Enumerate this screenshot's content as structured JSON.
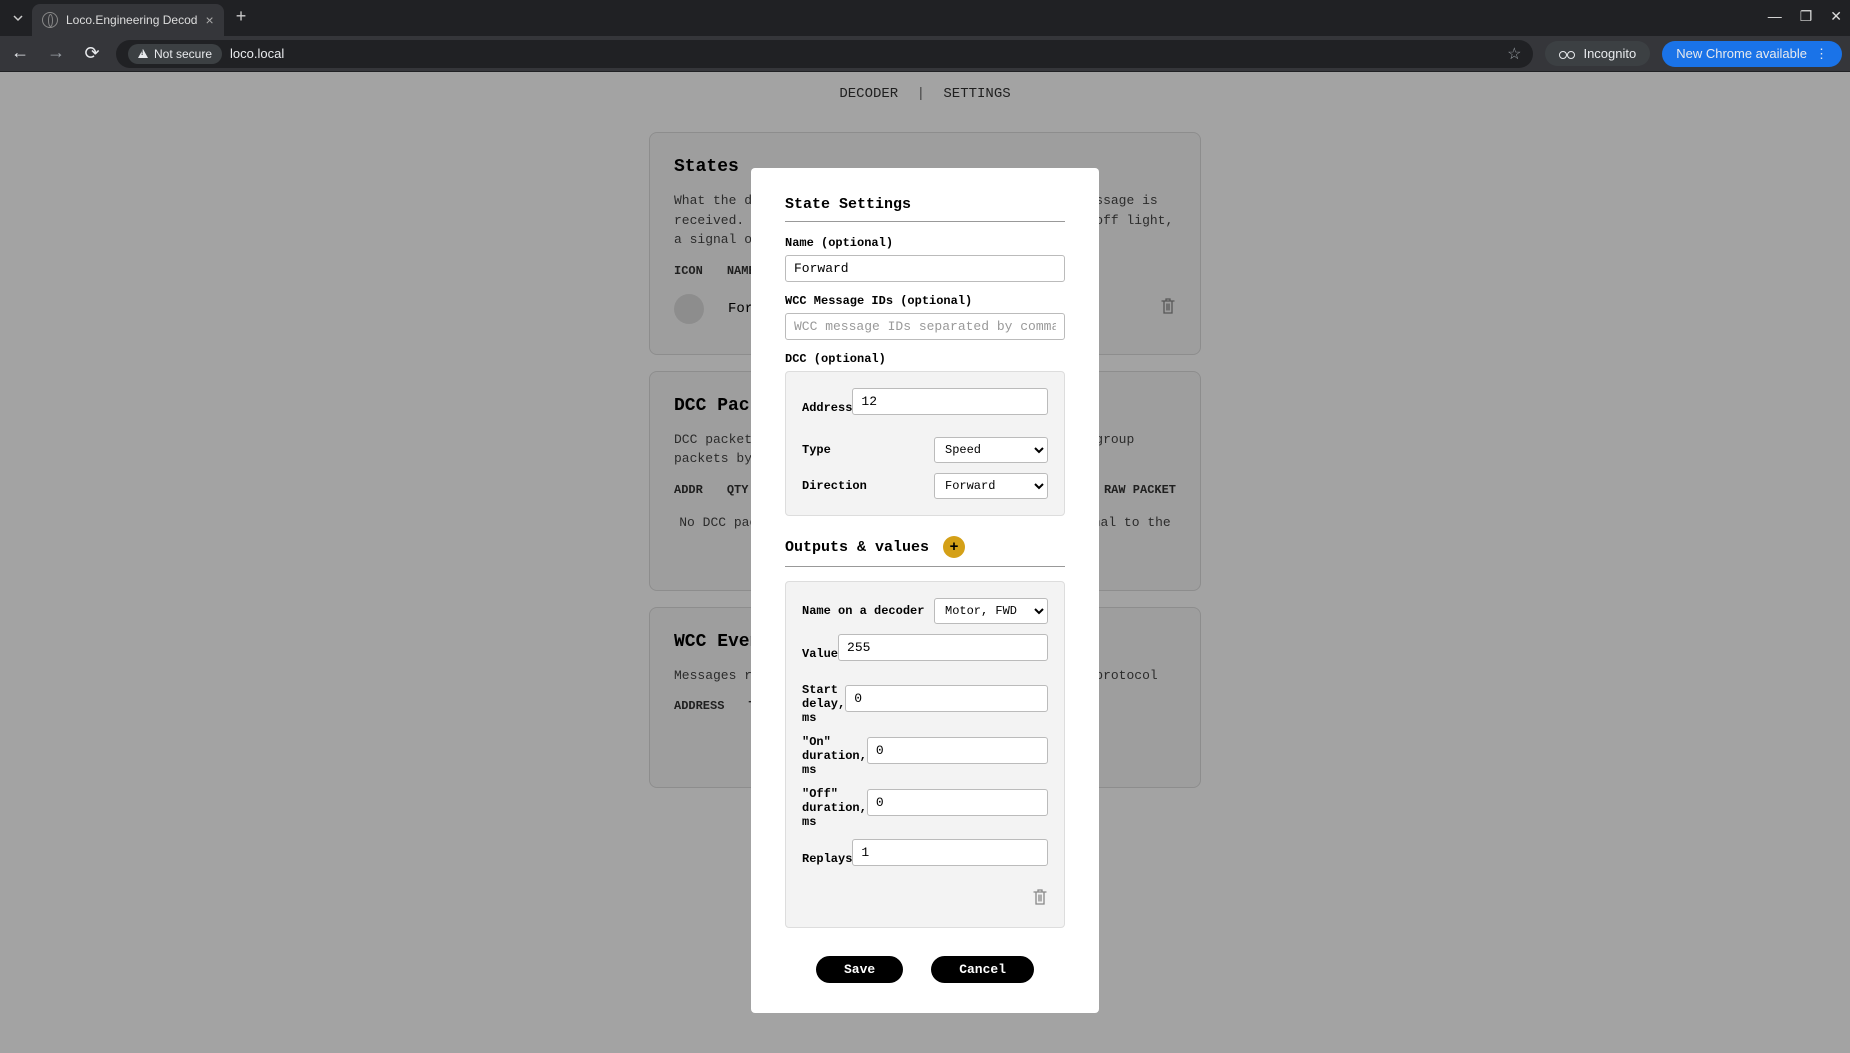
{
  "browser": {
    "tab_title": "Loco.Engineering Decod",
    "not_secure": "Not secure",
    "url": "loco.local",
    "incognito": "Incognito",
    "update": "New Chrome available"
  },
  "nav": {
    "decoder": "DECODER",
    "settings": "SETTINGS"
  },
  "states_card": {
    "title": "States",
    "desc": "What the decoder should do when a DCC packet or WCC message is received. For example, you can add a state to turn on/off light, a signal or play sound on a layout",
    "col_icon": "ICON",
    "col_name": "NAME",
    "row_name": "Forward"
  },
  "dcc_card": {
    "title": "DCC Packets",
    "desc": "DCC packets that the decoder receives. By default, we group packets by address and packet type",
    "col_addr": "ADDR",
    "col_qty": "QTY",
    "col_raw": "RAW PACKET",
    "empty": "No DCC packets received. Try to send a DCC packet/signal to the decoder"
  },
  "wcc_card": {
    "title": "WCC Events",
    "desc": "Messages received from other WCC devices over the WCC protocol",
    "col_addr": "ADDRESS",
    "col_type": "TYPE"
  },
  "modal": {
    "title": "State Settings",
    "name_label": "Name (optional)",
    "name_value": "Forward",
    "wcc_label": "WCC Message IDs (optional)",
    "wcc_placeholder": "WCC message IDs separated by comma",
    "dcc_label": "DCC (optional)",
    "dcc": {
      "address_label": "Address",
      "address_value": "12",
      "type_label": "Type",
      "type_value": "Speed",
      "direction_label": "Direction",
      "direction_value": "Forward"
    },
    "outputs_title": "Outputs & values",
    "output": {
      "name_label": "Name on a decoder",
      "name_value": "Motor, FWD",
      "value_label": "Value",
      "value_value": "255",
      "start_label": "Start delay, ms",
      "start_value": "0",
      "on_label": "\"On\" duration, ms",
      "on_value": "0",
      "off_label": "\"Off\" duration, ms",
      "off_value": "0",
      "replays_label": "Replays",
      "replays_value": "1"
    },
    "save": "Save",
    "cancel": "Cancel"
  }
}
